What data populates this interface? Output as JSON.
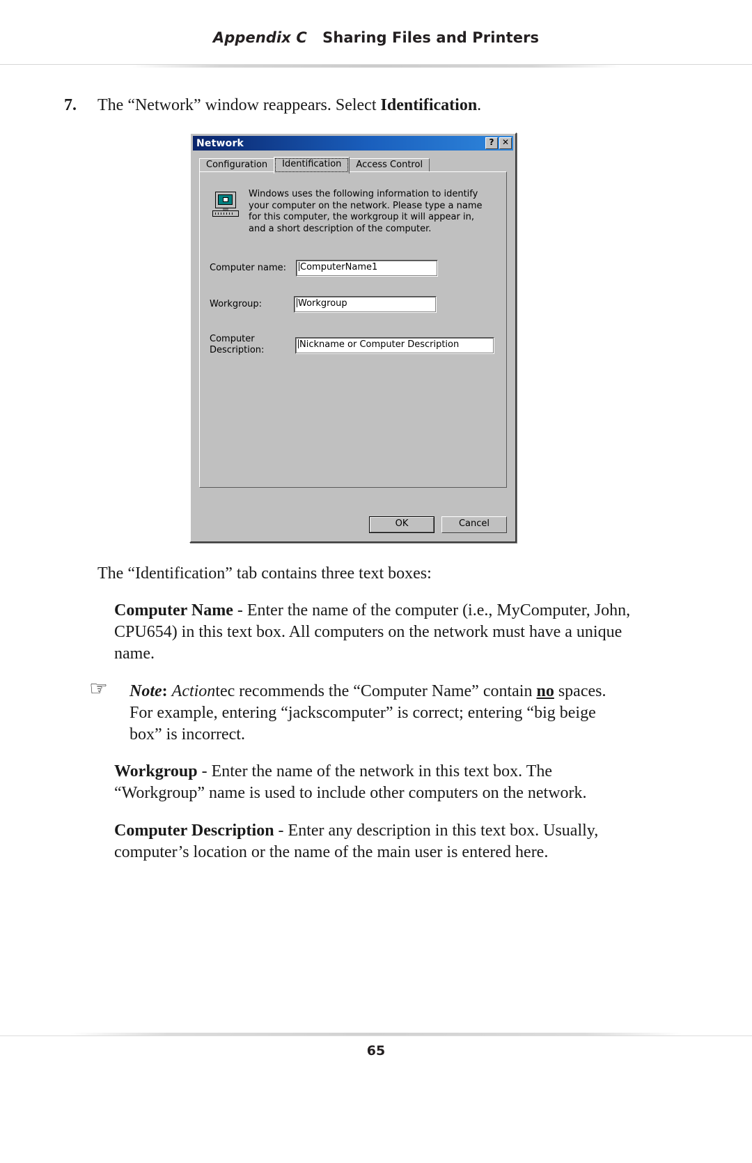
{
  "header": {
    "appendix": "Appendix C",
    "title": "Sharing Files and Printers"
  },
  "step": {
    "number": "7.",
    "text_before": "The “Network” window reappears. Select ",
    "bold_term": "Identification",
    "text_after": "."
  },
  "dialog": {
    "title": "Network",
    "titlebar_buttons": [
      {
        "name": "help-button",
        "glyph": "?"
      },
      {
        "name": "close-button",
        "glyph": "✕"
      }
    ],
    "tabs": [
      {
        "label": "Configuration",
        "selected": false
      },
      {
        "label": "Identification",
        "selected": true
      },
      {
        "label": "Access Control",
        "selected": false
      }
    ],
    "icon": "computer-network-icon",
    "description": "Windows uses the following information to identify your computer on the network.  Please type a name for this computer, the workgroup it will appear in, and a short description of the computer.",
    "fields": [
      {
        "label": "Computer name:",
        "value": "ComputerName1",
        "name": "computer-name"
      },
      {
        "label": "Workgroup:",
        "value": "Workgroup",
        "name": "workgroup"
      },
      {
        "label_line1": "Computer",
        "label_line2": "Description:",
        "value": "Nickname or Computer Description",
        "name": "computer-description"
      }
    ],
    "buttons": {
      "ok": "OK",
      "cancel": "Cancel"
    }
  },
  "body": {
    "intro": "The “Identification” tab contains three text boxes:",
    "computer_name": {
      "term": "Computer Name",
      "text": " - Enter the name of the computer (i.e., MyComputer, John, CPU654) in this text box. All computers on the network must have a unique name."
    },
    "note": {
      "icon": "☞",
      "label": "Note",
      "colon": ": ",
      "brand": "Action",
      "text_part1": "tec recommends the “Computer Name” contain ",
      "emphasis": "no",
      "text_part2": " spaces. For example, entering “jackscomputer” is correct; entering “big beige box” is incorrect."
    },
    "workgroup": {
      "term": "Workgroup",
      "text": " - Enter the name of the network in this text box. The “Workgroup” name is used to include other computers on the network."
    },
    "computer_description": {
      "term": "Computer Description",
      "text": " - Enter any description in this text box. Usually, computer’s location or the name of the main user is entered here."
    }
  },
  "footer": {
    "page_number": "65"
  }
}
